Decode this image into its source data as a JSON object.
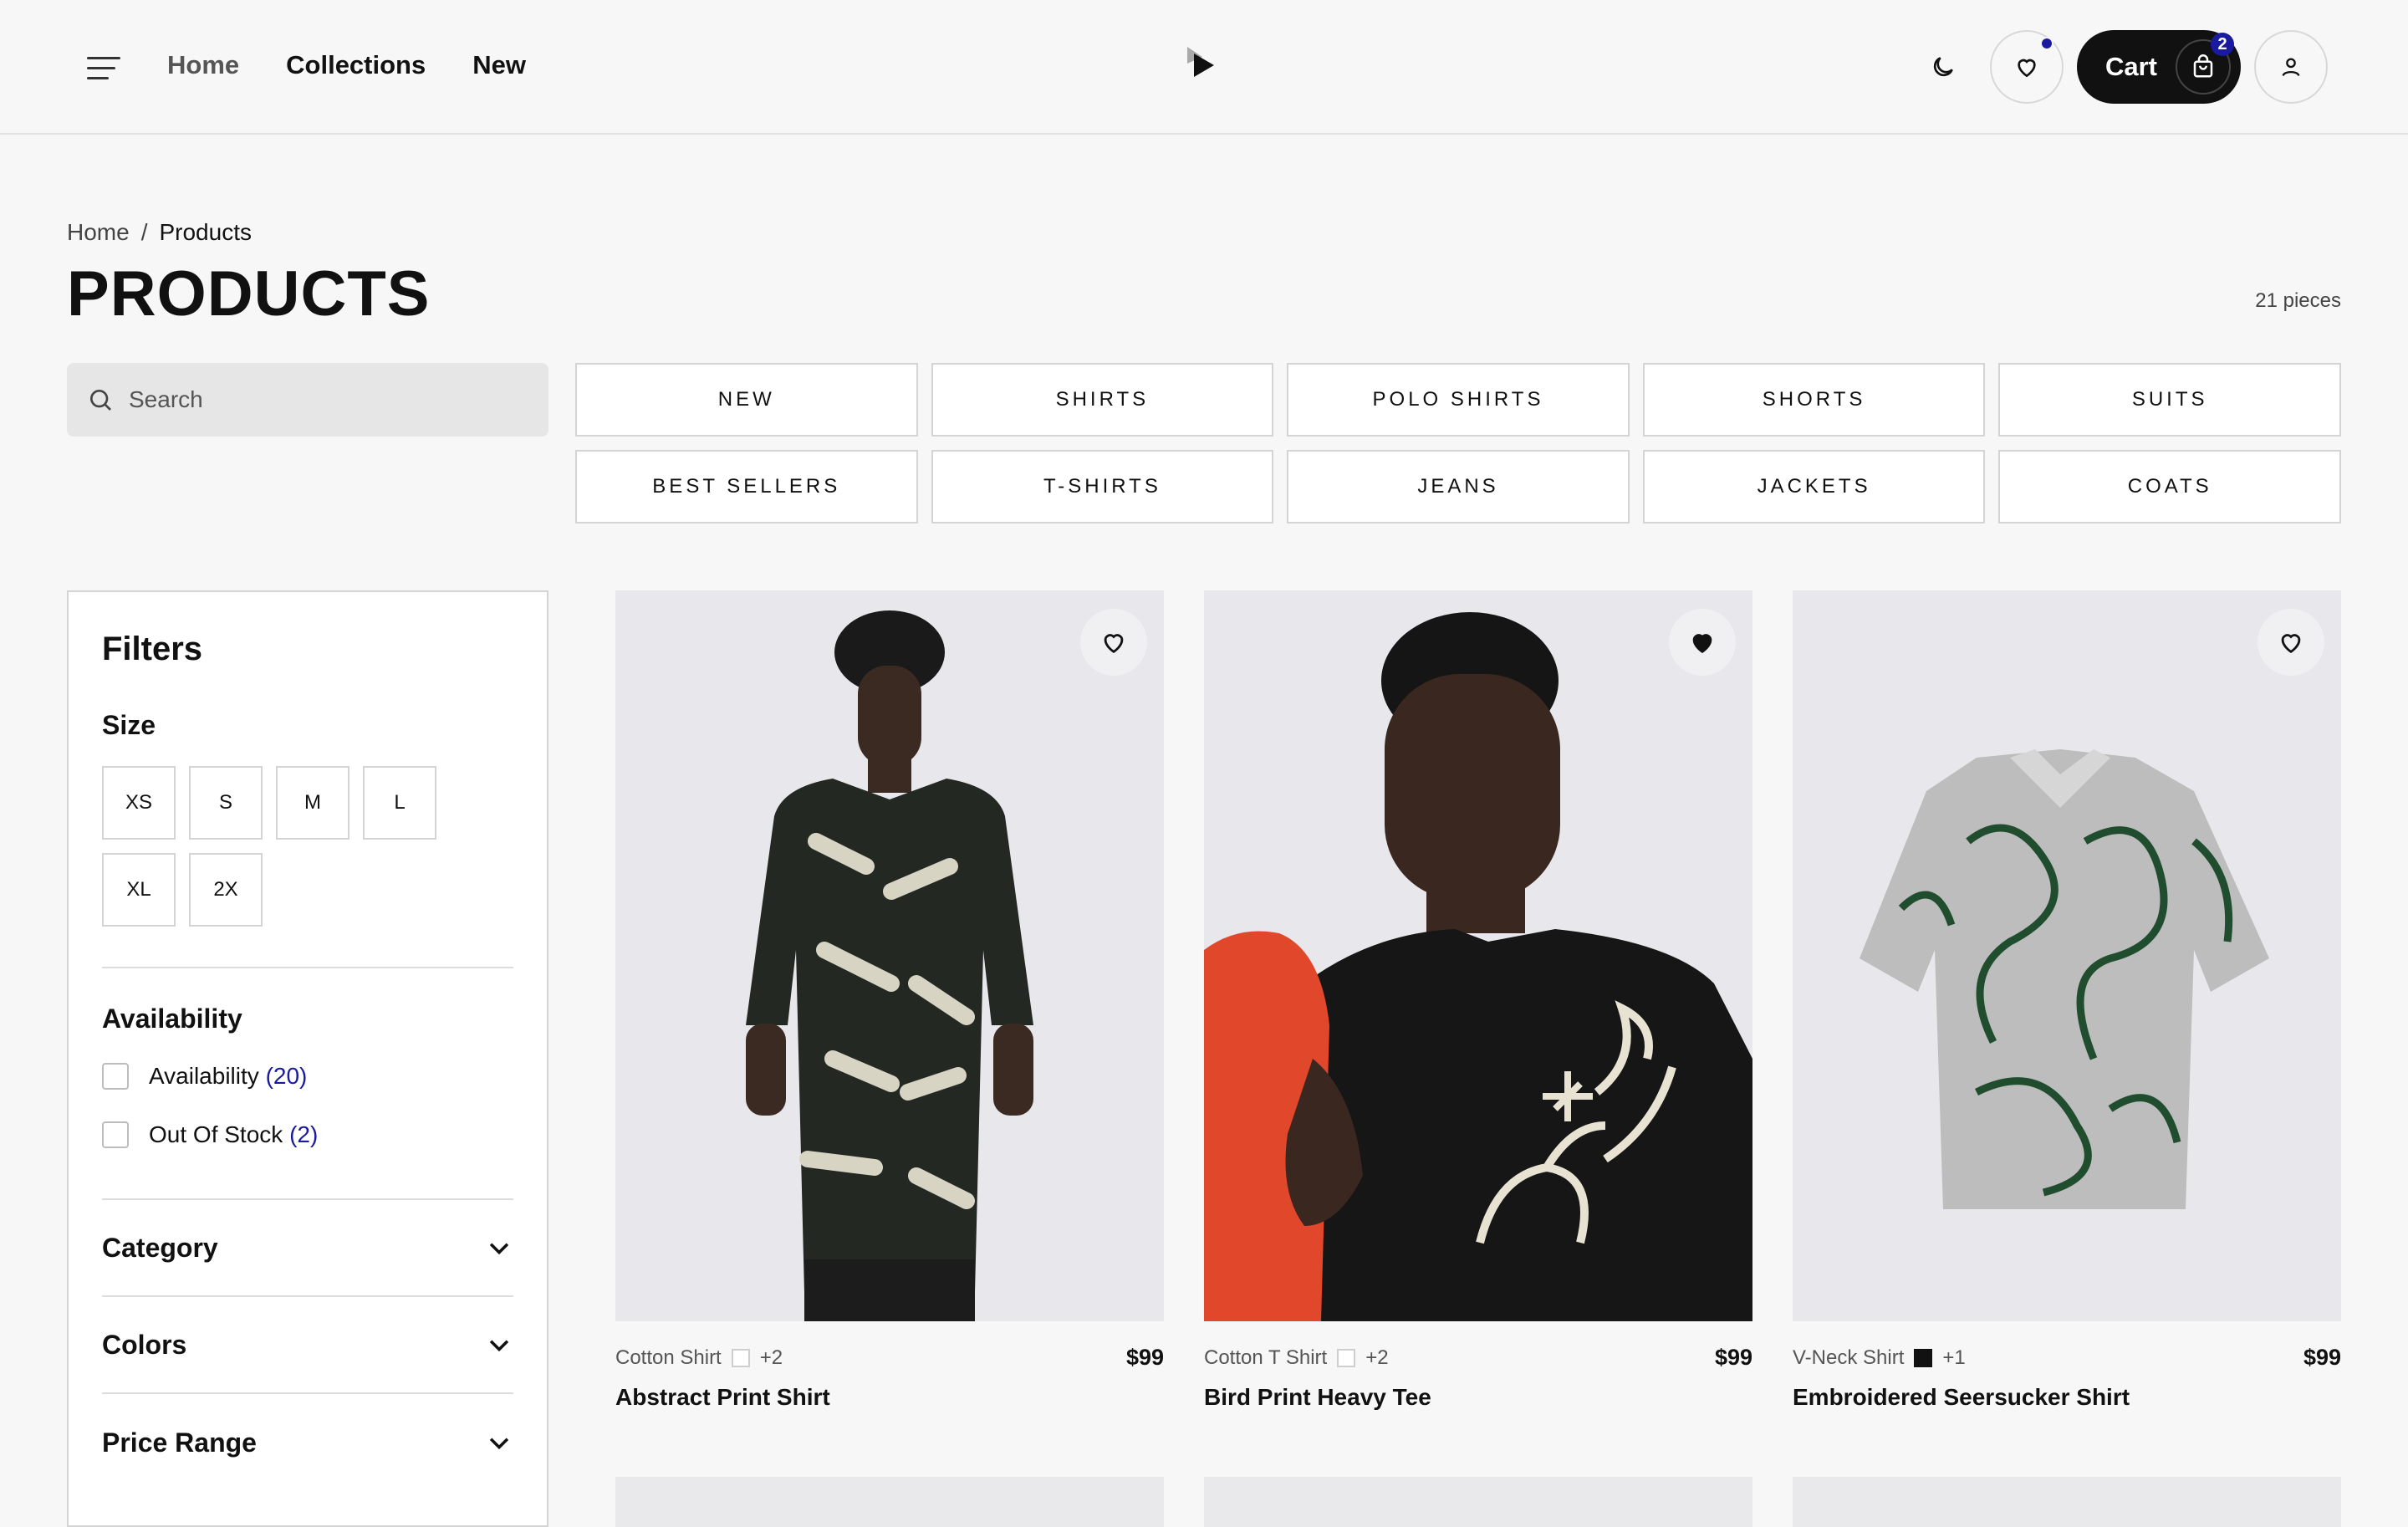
{
  "header": {
    "nav": [
      "Home",
      "Collections",
      "New"
    ],
    "cart_label": "Cart",
    "cart_count": "2"
  },
  "breadcrumb": {
    "home": "Home",
    "sep": "/",
    "current": "Products"
  },
  "page": {
    "title": "PRODUCTS",
    "count": "21 pieces"
  },
  "search": {
    "placeholder": "Search"
  },
  "categories": [
    "NEW",
    "SHIRTS",
    "POLO SHIRTS",
    "SHORTS",
    "SUITS",
    "BEST SELLERS",
    "T-SHIRTS",
    "JEANS",
    "JACKETS",
    "COATS"
  ],
  "filters": {
    "title": "Filters",
    "size_title": "Size",
    "sizes": [
      "XS",
      "S",
      "M",
      "L",
      "XL",
      "2X"
    ],
    "availability_title": "Availability",
    "availability": [
      {
        "label": "Availability",
        "count": "(20)"
      },
      {
        "label": "Out Of Stock",
        "count": "(2)"
      }
    ],
    "accordions": [
      "Category",
      "Colors",
      "Price Range"
    ]
  },
  "products": [
    {
      "type": "Cotton Shirt",
      "more": "+2",
      "swatch": "#ffffff",
      "price": "$99",
      "name": "Abstract Print Shirt",
      "favorited": false
    },
    {
      "type": "Cotton T Shirt",
      "more": "+2",
      "swatch": "#ffffff",
      "price": "$99",
      "name": "Bird Print Heavy Tee",
      "favorited": true
    },
    {
      "type": "V-Neck Shirt",
      "more": "+1",
      "swatch": "#111111",
      "price": "$99",
      "name": "Embroidered Seersucker Shirt",
      "favorited": false
    }
  ],
  "colors": {
    "accent": "#1a1aa0",
    "dark": "#111111"
  }
}
